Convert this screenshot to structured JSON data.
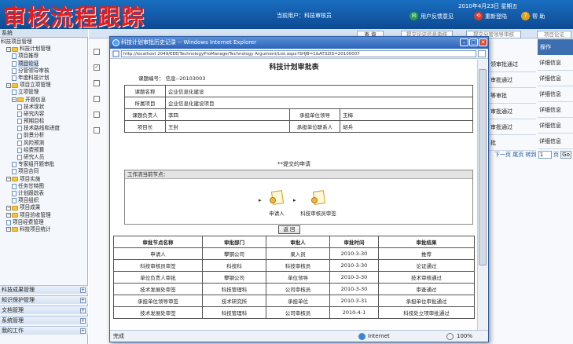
{
  "overlay_title": "审核流程跟踪",
  "header": {
    "current_user": "当前用户：科技审核员",
    "date": "2010年4月23日 星期五",
    "links": [
      {
        "label": "用户反馈意见",
        "icon": "feedback-icon"
      },
      {
        "label": "重新登陆",
        "icon": "relogin-icon"
      },
      {
        "label": "帮 助",
        "icon": "help-icon"
      }
    ]
  },
  "sidebar": {
    "system_label": "系统",
    "items": [
      {
        "label": "科技项目管理",
        "level": 0,
        "type": "header"
      },
      {
        "label": "科技计划管理",
        "level": 1,
        "type": "folder"
      },
      {
        "label": "项目推荐",
        "level": 2,
        "type": "doc"
      },
      {
        "label": "项目论证",
        "level": 2,
        "type": "doc",
        "active": true
      },
      {
        "label": "分管领导审核",
        "level": 2,
        "type": "doc"
      },
      {
        "label": "年度科技计划",
        "level": 2,
        "type": "doc"
      },
      {
        "label": "项目立项管理",
        "level": 1,
        "type": "folder"
      },
      {
        "label": "立项管理",
        "level": 2,
        "type": "doc"
      },
      {
        "label": "开题信息",
        "level": 2,
        "type": "folder"
      },
      {
        "label": "技术现状",
        "level": 3,
        "type": "doc"
      },
      {
        "label": "研究内容",
        "level": 3,
        "type": "doc"
      },
      {
        "label": "预期目标",
        "level": 3,
        "type": "doc"
      },
      {
        "label": "技术路线和进度",
        "level": 3,
        "type": "doc"
      },
      {
        "label": "前景分析",
        "level": 3,
        "type": "doc"
      },
      {
        "label": "风险预测",
        "level": 3,
        "type": "doc"
      },
      {
        "label": "经费预算",
        "level": 3,
        "type": "doc"
      },
      {
        "label": "研究人员",
        "level": 3,
        "type": "doc"
      },
      {
        "label": "专家组开题审批",
        "level": 2,
        "type": "doc"
      },
      {
        "label": "项目合同",
        "level": 2,
        "type": "doc"
      },
      {
        "label": "项目实施",
        "level": 1,
        "type": "folder"
      },
      {
        "label": "任务甘特图",
        "level": 2,
        "type": "doc"
      },
      {
        "label": "计划跟踪表",
        "level": 2,
        "type": "doc"
      },
      {
        "label": "项目组织",
        "level": 2,
        "type": "doc"
      },
      {
        "label": "项目成果",
        "level": 1,
        "type": "folder"
      },
      {
        "label": "项目验收管理",
        "level": 1,
        "type": "folder"
      },
      {
        "label": "项目经费管理",
        "level": 1,
        "type": "doc"
      },
      {
        "label": "科技项目统计",
        "level": 1,
        "type": "folder"
      }
    ],
    "sections": [
      "科技成果管理",
      "知识保护管理",
      "文档管理",
      "系统管理",
      "我的工作"
    ]
  },
  "background": {
    "buttons": [
      "查 询",
      "提交论证信息审核",
      "提交分管领导审核",
      "项目论证"
    ],
    "op_header": "操作",
    "right_rows": [
      {
        "status": "领审批通过",
        "action": "详细信息"
      },
      {
        "status": "审批通过",
        "action": "详细信息"
      },
      {
        "status": "等审批",
        "action": "详细信息"
      },
      {
        "status": "审批通过",
        "action": "详细信息"
      },
      {
        "status": "审批通过",
        "action": "详细信息"
      },
      {
        "status": "批",
        "action": "详细信息"
      }
    ],
    "pager": "下一页 尾页 转到",
    "pager_value": "1",
    "pager_unit": "页",
    "go_label": "Go"
  },
  "popup": {
    "window_title": "科技计划审批历史记录 -- Windows Internet Explorer",
    "address": "http://localhost 2049/EEE/TechnologyProManage/Technology Argument/List.aspx?SHJB=1&AT3ZIS=20100007",
    "doc_title": "科技计划审批表",
    "project_code": "课题编号：  信息--20103003",
    "info": {
      "name_label": "课题名称",
      "name_value": "企业信息化建设",
      "project_label": "所属项目",
      "project_value": "企业信息化建设项目",
      "owner_label": "课题负责人",
      "owner_value": "李四",
      "leader_label": "承担单位领导",
      "leader_value": "王梅",
      "pm_label": "项目长",
      "pm_value": "王封",
      "contact_label": "承担单位联系人",
      "contact_value": "胡兵"
    },
    "submit_title": "**提交的申请",
    "flow_header": "工作流当前节点：",
    "flow_nodes": [
      "申请人",
      "科技审核员审签"
    ],
    "return_label": "返 回",
    "history": {
      "headers": [
        "审批节点名称",
        "审批部门",
        "审批人",
        "审批时间",
        "审批结果"
      ],
      "rows": [
        [
          "申请人",
          "攀钢公司",
          "录入员",
          "2010-3-30",
          "推荐"
        ],
        [
          "科技审核员审签",
          "科技科",
          "科技审核员",
          "2010-3-30",
          "论证通过"
        ],
        [
          "单位负责人审批",
          "攀钢公司",
          "单位领导",
          "2010-3-30",
          "技术审核通过"
        ],
        [
          "技术发展处审签",
          "科技管理科",
          "公司审核员",
          "2010-3-30",
          "审查通过"
        ],
        [
          "承担单位领导审签",
          "技术研究所",
          "承担单位",
          "2010-3-31",
          "承担单位审批通过"
        ],
        [
          "技术发展处审签",
          "科技管理科",
          "公司审核员",
          "2010-4-1",
          "科技处立项审批通过"
        ]
      ]
    },
    "status_left": "完成",
    "status_zone": "Internet",
    "zoom": "100%"
  },
  "colors": {
    "header_blue": "#1a6fc0",
    "overlay_red": "#e81a1a",
    "titlebar_blue": "#2a62b9"
  }
}
